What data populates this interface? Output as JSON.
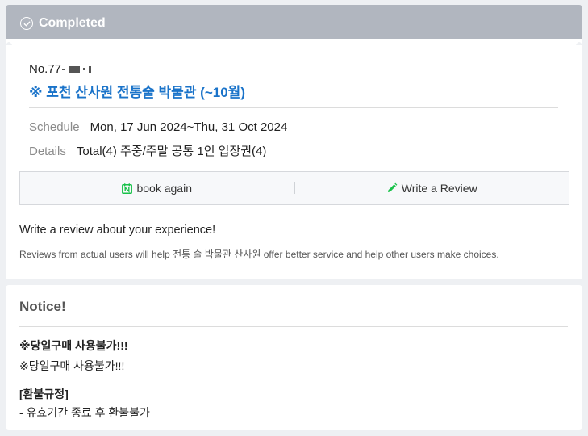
{
  "status": {
    "label": "Completed"
  },
  "booking": {
    "order_no": "No.77",
    "title": "※ 포천 산사원 전통술 박물관 (~10월)",
    "schedule_label": "Schedule",
    "schedule_value": "Mon, 17 Jun 2024~Thu, 31 Oct 2024",
    "details_label": "Details",
    "details_value": "Total(4) 주중/주말 공통 1인 입장권(4)"
  },
  "actions": {
    "book_again": "book again",
    "write_review": "Write a Review",
    "book_again_icon": "calendar-n-icon",
    "write_review_icon": "pencil-icon",
    "accent_green": "#19c24a"
  },
  "review_prompt": {
    "heading": "Write a review about your experience!",
    "sub": "Reviews from actual users will help 전통 술 박물관 산사원 offer better service and help other users make choices."
  },
  "notice": {
    "title": "Notice!",
    "lines": [
      "※당일구매 사용불가!!!",
      "※당일구매 사용불가!!!",
      "[환불규정]",
      "- 유효기간 종료 후 환불불가"
    ]
  },
  "colors": {
    "banner": "#b1b6bf",
    "title_blue": "#1a73c9"
  }
}
